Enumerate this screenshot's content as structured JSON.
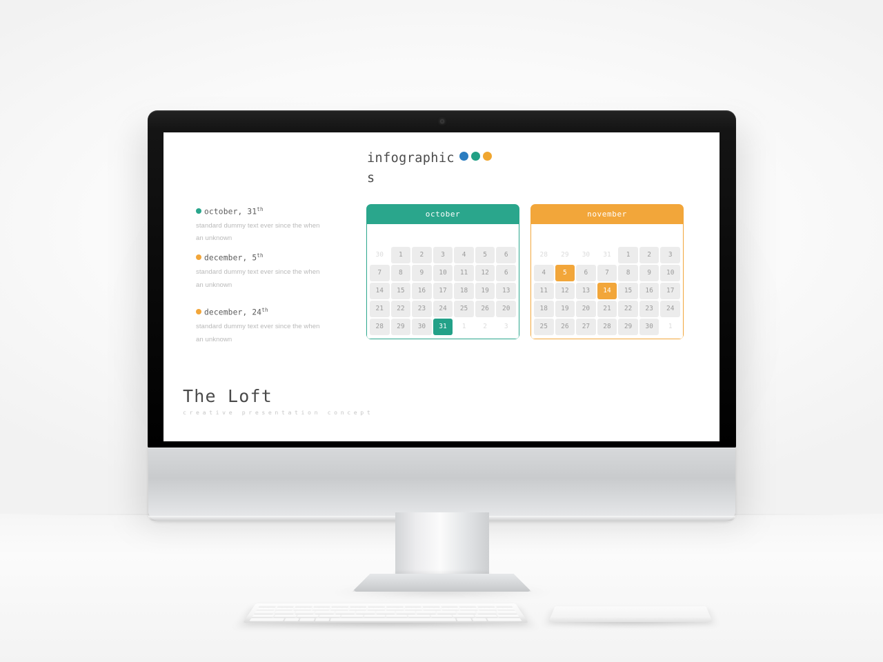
{
  "slide": {
    "title": "infographic",
    "title_wrap": "s",
    "title_dots": [
      {
        "name": "dot-blue",
        "color": "#2b7dc0"
      },
      {
        "name": "dot-teal",
        "color": "#22a085"
      },
      {
        "name": "dot-orange",
        "color": "#f0a62f"
      }
    ],
    "legend": [
      {
        "bullet_color": "#2aa68c",
        "label": "october, 31",
        "suffix": "th",
        "body_line1": "standard dummy text ever since the when",
        "body_line2": "an unknown"
      },
      {
        "bullet_color": "#f2a63a",
        "label": "december, 5",
        "suffix": "th",
        "body_line1": "standard dummy text ever since the when",
        "body_line2": "an unknown"
      },
      {
        "bullet_color": "#f2a63a",
        "label": "december, 24",
        "suffix": "th",
        "body_line1": "standard dummy text ever since the when",
        "body_line2": "an unknown"
      }
    ],
    "calendars": [
      {
        "name": "october",
        "title": "october",
        "accent": "#2aa68c",
        "weeks": [
          [
            {
              "d": "30",
              "s": "muted"
            },
            {
              "d": "1"
            },
            {
              "d": "2"
            },
            {
              "d": "3"
            },
            {
              "d": "4"
            },
            {
              "d": "5"
            },
            {
              "d": "6"
            }
          ],
          [
            {
              "d": "7"
            },
            {
              "d": "8"
            },
            {
              "d": "9"
            },
            {
              "d": "10"
            },
            {
              "d": "11"
            },
            {
              "d": "12"
            },
            {
              "d": "6"
            }
          ],
          [
            {
              "d": "14"
            },
            {
              "d": "15"
            },
            {
              "d": "16"
            },
            {
              "d": "17"
            },
            {
              "d": "18"
            },
            {
              "d": "19"
            },
            {
              "d": "13"
            }
          ],
          [
            {
              "d": "21"
            },
            {
              "d": "22"
            },
            {
              "d": "23"
            },
            {
              "d": "24"
            },
            {
              "d": "25"
            },
            {
              "d": "26"
            },
            {
              "d": "20"
            }
          ],
          [
            {
              "d": "28"
            },
            {
              "d": "29"
            },
            {
              "d": "30"
            },
            {
              "d": "31",
              "s": "hl-green"
            },
            {
              "d": "1",
              "s": "muted"
            },
            {
              "d": "2",
              "s": "muted"
            },
            {
              "d": "3",
              "s": "muted"
            }
          ]
        ]
      },
      {
        "name": "november",
        "title": "november",
        "accent": "#f2a63a",
        "weeks": [
          [
            {
              "d": "28",
              "s": "muted"
            },
            {
              "d": "29",
              "s": "muted"
            },
            {
              "d": "30",
              "s": "muted"
            },
            {
              "d": "31",
              "s": "muted"
            },
            {
              "d": "1"
            },
            {
              "d": "2"
            },
            {
              "d": "3"
            }
          ],
          [
            {
              "d": "4"
            },
            {
              "d": "5",
              "s": "hl-orange"
            },
            {
              "d": "6"
            },
            {
              "d": "7"
            },
            {
              "d": "8"
            },
            {
              "d": "9"
            },
            {
              "d": "10"
            }
          ],
          [
            {
              "d": "11"
            },
            {
              "d": "12"
            },
            {
              "d": "13"
            },
            {
              "d": "14",
              "s": "hl-orange"
            },
            {
              "d": "15"
            },
            {
              "d": "16"
            },
            {
              "d": "17"
            }
          ],
          [
            {
              "d": "18"
            },
            {
              "d": "19"
            },
            {
              "d": "20"
            },
            {
              "d": "21"
            },
            {
              "d": "22"
            },
            {
              "d": "23"
            },
            {
              "d": "24"
            }
          ],
          [
            {
              "d": "25"
            },
            {
              "d": "26"
            },
            {
              "d": "27"
            },
            {
              "d": "28"
            },
            {
              "d": "29"
            },
            {
              "d": "30"
            },
            {
              "d": "1",
              "s": "muted"
            }
          ]
        ]
      }
    ],
    "footer": {
      "title": "The Loft",
      "subtitle": "creative presentation concept"
    }
  },
  "device": {
    "keyboard_label": "keyboard",
    "trackpad_label": "trackpad",
    "webcam_label": "webcam"
  }
}
